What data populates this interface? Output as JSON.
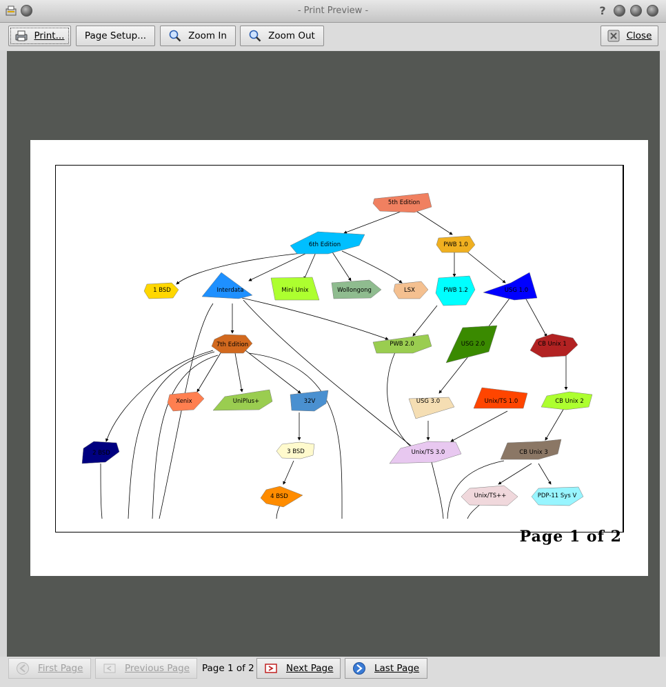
{
  "window": {
    "title": "- Print Preview -"
  },
  "toolbar": {
    "print": "Print...",
    "page_setup": "Page Setup...",
    "zoom_in": "Zoom In",
    "zoom_out": "Zoom Out",
    "close": "Close"
  },
  "preview": {
    "page_label": "Page 1 of 2",
    "graph": {
      "nodes": {
        "n5th": "5th Edition",
        "n6th": "6th Edition",
        "pwb10": "PWB 1.0",
        "bsd1": "1 BSD",
        "interdata": "Interdata",
        "miniunix": "Mini Unix",
        "wollongong": "Wollongong",
        "lsx": "LSX",
        "pwb12": "PWB 1.2",
        "usg10": "USG 1.0",
        "ed7": "7th Edition",
        "pwb20": "PWB 2.0",
        "usg20": "USG 2.0",
        "cbunix1": "CB Unix 1",
        "xenix": "Xenix",
        "uniplus": "UniPlus+",
        "v32": "32V",
        "usg30": "USG 3.0",
        "unixts10": "Unix/TS 1.0",
        "cbunix2": "CB Unix 2",
        "bsd2": "2 BSD",
        "bsd3": "3 BSD",
        "unixts30": "Unix/TS 3.0",
        "cbunix3": "CB Unix 3",
        "bsd4": "4 BSD",
        "unixtspp": "Unix/TS++",
        "pdp11": "PDP-11 Sys V"
      }
    }
  },
  "navigation": {
    "first": "First Page",
    "previous": "Previous Page",
    "page_count": "Page 1 of 2",
    "next": "Next Page",
    "last": "Last Page"
  }
}
